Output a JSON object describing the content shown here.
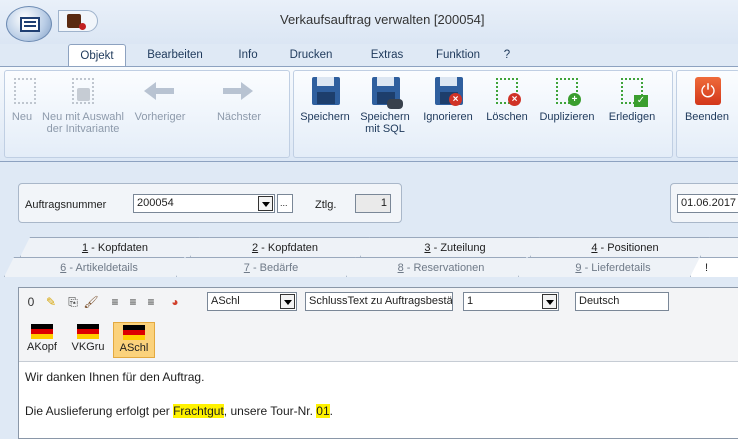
{
  "window": {
    "title": "Verkaufsauftrag verwalten [200054]"
  },
  "ribbon_tabs": [
    {
      "label": "Objekt",
      "active": true
    },
    {
      "label": "Bearbeiten"
    },
    {
      "label": "Info"
    },
    {
      "label": "Drucken"
    },
    {
      "label": "Extras"
    },
    {
      "label": "Funktion"
    },
    {
      "label": "?"
    }
  ],
  "ribbon": {
    "neu": "Neu",
    "neu_auswahl_1": "Neu mit Auswahl",
    "neu_auswahl_2": "der Initvariante",
    "vorheriger": "Vorheriger",
    "naechster": "Nächster",
    "speichern": "Speichern",
    "speichern_sql_1": "Speichern",
    "speichern_sql_2": "mit SQL",
    "ignorieren": "Ignorieren",
    "loeschen": "Löschen",
    "duplizieren": "Duplizieren",
    "erledigen": "Erledigen",
    "beenden": "Beenden"
  },
  "form": {
    "auftragsnummer_label": "Auftragsnummer",
    "auftragsnummer_value": "200054",
    "ellipsis": "...",
    "ztlg_label": "Ztlg.",
    "ztlg_value": "1",
    "date_value": "01.06.2017"
  },
  "tabs_row1": [
    {
      "key": "1",
      "rest": " - Kopfdaten"
    },
    {
      "key": "2",
      "rest": " - Kopfdaten"
    },
    {
      "key": "3",
      "rest": " - Zuteilung"
    },
    {
      "key": "4",
      "rest": " - Positionen"
    }
  ],
  "tabs_row2": [
    {
      "key": "6",
      "rest": " - Artikeldetails"
    },
    {
      "key": "7",
      "rest": " - Bedärfe"
    },
    {
      "key": "8",
      "rest": " - Reservationen"
    },
    {
      "key": "9",
      "rest": " - Lieferdetails"
    }
  ],
  "tab_partial_letter": "!",
  "editor": {
    "zero_button": "0",
    "text_select": "ASchl",
    "text_type": "SchlussText zu Auftragsbestätigung",
    "number": "1",
    "language": "Deutsch",
    "flags": [
      {
        "label": "AKopf",
        "active": false
      },
      {
        "label": "VKGru",
        "active": false
      },
      {
        "label": "ASchl",
        "active": true
      }
    ],
    "line1": "Wir danken Ihnen für den Auftrag.",
    "line2_before": "Die Auslieferung erfolgt per ",
    "line2_hl1": "Frachtgut",
    "line2_mid": ", unsere Tour-Nr. ",
    "line2_hl2": "01",
    "line2_after": "."
  },
  "colors": {
    "highlight": "#fff200",
    "ribbon_bg": "#dce7f5",
    "accent_flag_active": "#fbd27c"
  }
}
